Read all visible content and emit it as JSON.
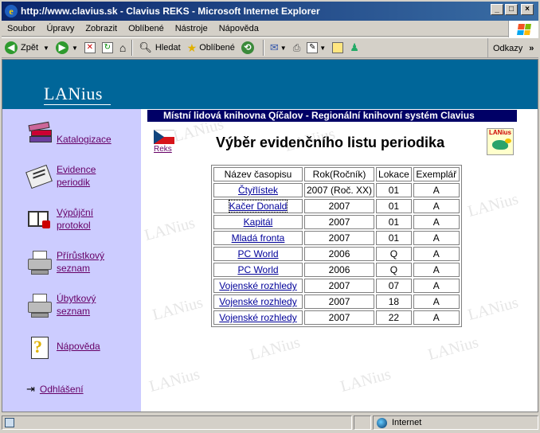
{
  "window": {
    "title": "http://www.clavius.sk - Clavius REKS - Microsoft Internet Explorer"
  },
  "menu": [
    "Soubor",
    "Úpravy",
    "Zobrazit",
    "Oblíbené",
    "Nástroje",
    "Nápověda"
  ],
  "toolbar": {
    "back_label": "Zpět",
    "search_label": "Hledat",
    "favorites_label": "Oblíbené",
    "links_label": "Odkazy"
  },
  "header": {
    "logo_main": "LANius"
  },
  "sidebar": {
    "items": [
      {
        "label": "Katalogizace",
        "icon": "books-icon"
      },
      {
        "label": "Evidence periodik",
        "icon": "newspaper-icon"
      },
      {
        "label": "Výpůjční protokol",
        "icon": "book-reader-icon"
      },
      {
        "label": "Přírůstkový seznam",
        "icon": "printer-icon"
      },
      {
        "label": "Úbytkový seznam",
        "icon": "printer-icon"
      },
      {
        "label": "Nápověda",
        "icon": "help-icon"
      }
    ],
    "logout": "Odhlášení"
  },
  "main": {
    "banner": "Místní lidová knihovna Qíčalov - Regionální knihovní systém Clavius",
    "reks_link": "Reks",
    "mini_logo": "LANius",
    "title": "Výběr evidenčního listu periodika",
    "table": {
      "headers": [
        "Název časopisu",
        "Rok(Ročník)",
        "Lokace",
        "Exemplář"
      ],
      "rows": [
        [
          "Čtyřlístek",
          "2007 (Roč. XX)",
          "01",
          "A"
        ],
        [
          "Kačer Donald",
          "2007",
          "01",
          "A"
        ],
        [
          "Kapitál",
          "2007",
          "01",
          "A"
        ],
        [
          "Mladá fronta",
          "2007",
          "01",
          "A"
        ],
        [
          "PC World",
          "2006",
          "Q",
          "A"
        ],
        [
          "PC World",
          "2006",
          "Q",
          "A"
        ],
        [
          "Vojenské rozhledy",
          "2007",
          "07",
          "A"
        ],
        [
          "Vojenské rozhledy",
          "2007",
          "18",
          "A"
        ],
        [
          "Vojenské rozhledy",
          "2007",
          "22",
          "A"
        ]
      ]
    },
    "watermark": "LANius"
  },
  "statusbar": {
    "zone": "Internet"
  }
}
